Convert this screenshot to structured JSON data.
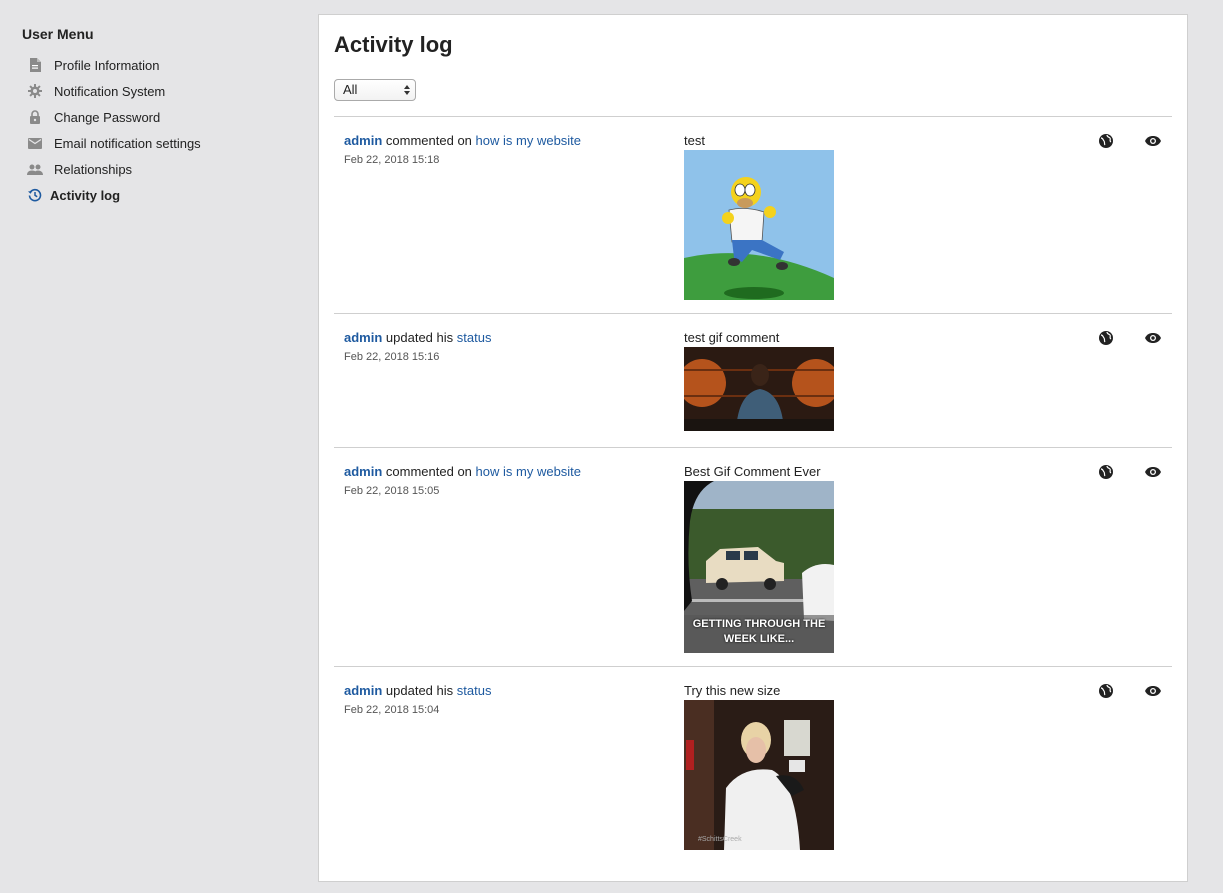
{
  "sidebar": {
    "title": "User Menu",
    "items": [
      {
        "label": "Profile Information",
        "icon": "document-icon"
      },
      {
        "label": "Notification System",
        "icon": "gear-icon"
      },
      {
        "label": "Change Password",
        "icon": "lock-icon"
      },
      {
        "label": "Email notification settings",
        "icon": "envelope-icon"
      },
      {
        "label": "Relationships",
        "icon": "people-icon"
      },
      {
        "label": "Activity log",
        "icon": "history-icon",
        "active": true
      }
    ]
  },
  "main": {
    "title": "Activity log",
    "filter": {
      "selected": "All"
    },
    "entries": [
      {
        "user": "admin",
        "verb": "commented on",
        "target": "how is my website",
        "date": "Feb 22, 2018 15:18",
        "content": "test",
        "gif": "cartoon-character-jumping"
      },
      {
        "user": "admin",
        "verb": "updated his",
        "target": "status",
        "date": "Feb 22, 2018 15:16",
        "content": "test gif comment",
        "gif": "man-at-desk"
      },
      {
        "user": "admin",
        "verb": "commented on",
        "target": "how is my website",
        "date": "Feb 22, 2018 15:05",
        "content": "Best Gif Comment Ever",
        "gif": "car-drifting",
        "gif_caption": "GETTING THROUGH THE WEEK LIKE..."
      },
      {
        "user": "admin",
        "verb": "updated his",
        "target": "status",
        "date": "Feb 22, 2018 15:04",
        "content": "Try this new size",
        "gif": "woman-dancing",
        "gif_watermark": "#SchittsCreek"
      }
    ]
  },
  "colors": {
    "link": "#1e5aa0",
    "background": "#e5e5e7",
    "active_icon": "#1e5aa0",
    "icon_gray": "#8a8a8a"
  }
}
